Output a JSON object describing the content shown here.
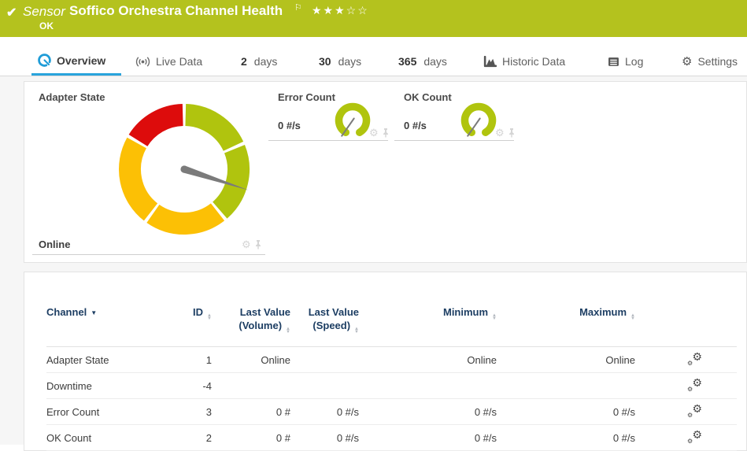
{
  "colors": {
    "topbar_green": "#b4c21e",
    "accent_blue": "#1f9cd7",
    "gauge_green": "#b0c40e",
    "gauge_yellow": "#fcc005",
    "gauge_red": "#dd0c0c",
    "needle_gray": "#7b7b7b",
    "header_navy": "#1d3e63",
    "icon_muted": "#d5d5d5",
    "icon_dark": "#555555"
  },
  "icons": {
    "check": "✔",
    "flag": "⚐",
    "gear": "⚙",
    "caret_down": "▼",
    "sort_asc": "▲",
    "sort_desc": "▼"
  },
  "topbar": {
    "type_label": "Sensor",
    "title": "Soffico Orchestra Channel Health",
    "status": "OK",
    "stars_filled": "★★★",
    "stars_empty": "☆☆"
  },
  "tabs": {
    "overview": "Overview",
    "live_data": "Live Data",
    "d2_num": "2",
    "d2_label": "days",
    "d30_num": "30",
    "d30_label": "days",
    "d365_num": "365",
    "d365_label": "days",
    "historic": "Historic Data",
    "log": "Log",
    "settings": "Settings"
  },
  "gauges": {
    "main": {
      "title": "Adapter State",
      "value": "Online"
    },
    "mini": [
      {
        "title": "Error Count",
        "value": "0 #/s"
      },
      {
        "title": "OK Count",
        "value": "0 #/s"
      }
    ]
  },
  "table": {
    "headers": [
      "Channel",
      "ID",
      "Last Value (Volume)",
      "Last Value (Speed)",
      "Minimum",
      "Maximum"
    ],
    "rows": [
      [
        "Adapter State",
        "1",
        "Online",
        "",
        "Online",
        "Online"
      ],
      [
        "Downtime",
        "-4",
        "",
        "",
        "",
        ""
      ],
      [
        "Error Count",
        "3",
        "0 #",
        "0 #/s",
        "0 #/s",
        "0 #/s"
      ],
      [
        "OK Count",
        "2",
        "0 #",
        "0 #/s",
        "0 #/s",
        "0 #/s"
      ]
    ]
  }
}
